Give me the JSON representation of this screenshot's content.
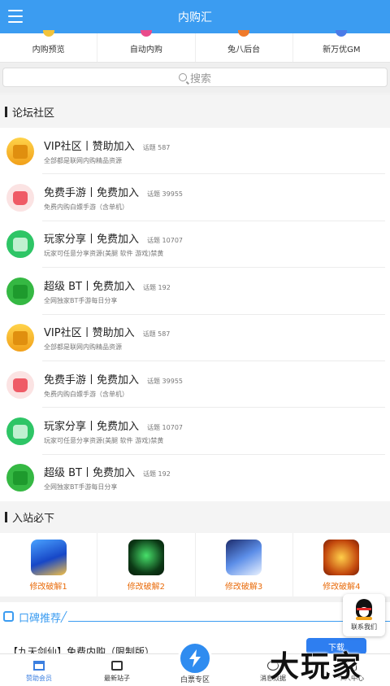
{
  "app": {
    "title": "内购汇"
  },
  "top_nav": [
    {
      "label": "内购预览",
      "icon": "crown-icon",
      "color": "#f3c33a"
    },
    {
      "label": "自动内购",
      "icon": "doc-icon",
      "color": "#ea4b8a"
    },
    {
      "label": "兔八后台",
      "icon": "rabbit-icon",
      "color": "#f07a2a"
    },
    {
      "label": "新万优GM",
      "icon": "gm-icon",
      "color": "#4a7be8"
    }
  ],
  "search": {
    "placeholder": "搜索"
  },
  "forum": {
    "title": "论坛社区",
    "items": [
      {
        "title": "VIP社区丨赞助加入",
        "count": "话题 587",
        "desc": "全部都是联网内购精品资源",
        "icon": "vip-folder-icon",
        "style": "gold"
      },
      {
        "title": "免费手游丨免费加入",
        "count": "话题 39955",
        "desc": "免费内购白嫖手游（含单机）",
        "icon": "game-gift-icon",
        "style": "red"
      },
      {
        "title": "玩家分享丨免费加入",
        "count": "话题 10707",
        "desc": "玩家可任意分享资源(美腿 软件 游戏)禁黄",
        "icon": "share-wifi-icon",
        "style": "green"
      },
      {
        "title": "超级 BT丨免费加入",
        "count": "话题 192",
        "desc": "全网独家BT手游每日分享",
        "icon": "bt-box-icon",
        "style": "green2"
      },
      {
        "title": "VIP社区丨赞助加入",
        "count": "话题 587",
        "desc": "全部都是联网内购精品资源",
        "icon": "vip-folder-icon",
        "style": "gold"
      },
      {
        "title": "免费手游丨免费加入",
        "count": "话题 39955",
        "desc": "免费内购白嫖手游（含单机）",
        "icon": "game-gift-icon",
        "style": "red"
      },
      {
        "title": "玩家分享丨免费加入",
        "count": "话题 10707",
        "desc": "玩家可任意分享资源(美腿 软件 游戏)禁黄",
        "icon": "share-wifi-icon",
        "style": "green"
      },
      {
        "title": "超级 BT丨免费加入",
        "count": "话题 192",
        "desc": "全网独家BT手游每日分享",
        "icon": "bt-box-icon",
        "style": "green2"
      }
    ]
  },
  "must_visit": {
    "title": "入站必下",
    "items": [
      {
        "label": "修改破解1",
        "thumb": "t1"
      },
      {
        "label": "修改破解2",
        "thumb": "t2"
      },
      {
        "label": "修改破解3",
        "thumb": "t3"
      },
      {
        "label": "修改破解4",
        "thumb": "t4"
      }
    ]
  },
  "koubei": {
    "title": "口碑推荐",
    "first_item_title": "【九天剑仙】免费内购（限制版）",
    "first_item_button": "下载"
  },
  "contact": {
    "label": "联系我们"
  },
  "tabbar": [
    {
      "label": "赞助会员",
      "icon": "bank-icon",
      "active": true
    },
    {
      "label": "最新站子",
      "icon": "calendar-icon",
      "active": false
    },
    {
      "label": "白票专区",
      "icon": "lightning-icon",
      "active": false
    },
    {
      "label": "消息数据",
      "icon": "chat-icon",
      "active": false
    },
    {
      "label": "个人中心",
      "icon": "user-icon",
      "active": false
    }
  ],
  "watermark": "大玩家"
}
